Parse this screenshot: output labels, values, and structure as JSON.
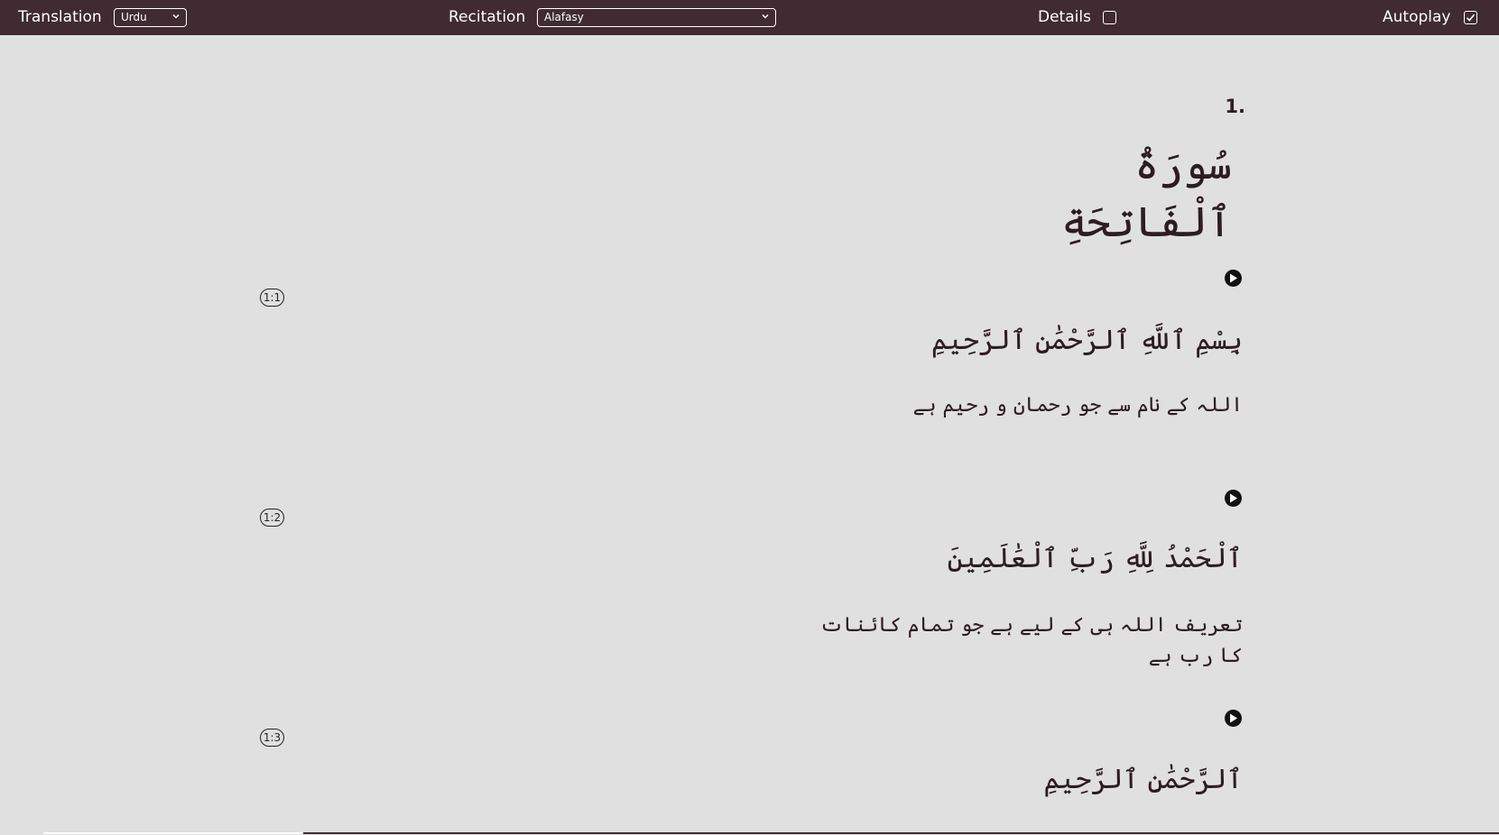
{
  "toolbar": {
    "translation_label": "Translation",
    "translation_value": "Urdu",
    "recitation_label": "Recitation",
    "recitation_value": "Alafasy",
    "details_label": "Details",
    "details_checked": false,
    "autoplay_label": "Autoplay",
    "autoplay_checked": true
  },
  "surah": {
    "number": "1.",
    "title": "سُورَةُ ٱلْفَاتِحَةِ"
  },
  "verses": [
    {
      "ref": "1:1",
      "arabic": "بِسْمِ ٱللَّهِ ٱلرَّحْمَٰنِ ٱلرَّحِيمِ",
      "translation": "اللہ کے نام سے جو رحمان و رحیم ہے"
    },
    {
      "ref": "1:2",
      "arabic": "ٱلْحَمْدُ لِلَّهِ رَبِّ ٱلْعَٰلَمِينَ",
      "translation": "تعریف اللہ ہی کے لیے ہے جو تمام کائنات کا رب ہے"
    },
    {
      "ref": "1:3",
      "arabic": "ٱلرَّحْمَٰنِ ٱلرَّحِيمِ"
    }
  ],
  "colors": {
    "toolbar_bg": "#3f2b31",
    "page_bg": "#e0e0e0",
    "text": "#2c1d21"
  }
}
